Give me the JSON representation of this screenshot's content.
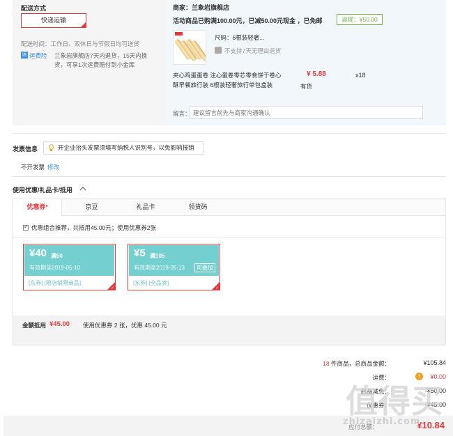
{
  "delivery": {
    "title": "配送方式",
    "method_button": "快递运输",
    "time_text": "配送时间：工作日、双休日与节假日均可送货",
    "insurance_icon": "运",
    "insurance_label": "运费险",
    "insurance_desc": "兰象岩旗舰店7天内退货，15天内换货，可享1次运费赔付到小金库"
  },
  "shop": {
    "name": "商家：兰象岩旗舰店",
    "promo": "活动商品已购满100.00元，已减50.00元现金 ，已免邮",
    "rebate": "返现：¥50.00"
  },
  "product": {
    "spec": "尺码：6根装轻奢...",
    "no_return": "不支持7天无理由退货",
    "name": "夹心鸡蛋蛋卷 注心蛋卷零芯零食饼干卷心酥早餐旅行装 6根装轻奢旅行单包盒装",
    "price": "¥ 5.88",
    "stock": "有货",
    "qty": "x18"
  },
  "memo": {
    "label": "留言：",
    "placeholder": "建议留言前先与商家沟通确认"
  },
  "invoice": {
    "title": "发票信息",
    "tip": "开企业抬头发票须填写纳税人识别号，以免影响报销",
    "value": "不开发票",
    "edit": "修改"
  },
  "coupon_section": {
    "title": "使用优惠/礼品卡/抵用",
    "tabs": [
      {
        "label": "优惠券",
        "mark": "*"
      },
      {
        "label": "京豆"
      },
      {
        "label": "礼品卡"
      },
      {
        "label": "领货码"
      }
    ],
    "combo_text": "优惠组合推荐，共抵用45.00元；使用优惠券2张",
    "coupons": [
      {
        "amount": "¥40",
        "condition": "满50",
        "expiry": "有效期至2019-05-10",
        "scope": "[东券] [限店铺限商品]"
      },
      {
        "amount": "¥5",
        "condition": "满105",
        "expiry": "有效期至2019-05-13",
        "stack": "可叠加",
        "scope": "[东券] [全品类]"
      }
    ],
    "sum_label": "金额抵用",
    "sum_value": "¥45.00",
    "sum_desc": "使用优惠券 2 张，优惠 45.00 元"
  },
  "totals": {
    "count": "18",
    "count_suffix": " 件商品，总商品金额：",
    "goods_total": "¥105.84",
    "shipping_label": "运费：",
    "shipping_value": "¥0.00",
    "discount_label": "商品减免：",
    "discount_value": "-¥50.00",
    "coupon_label": "优惠券：",
    "coupon_value": "-¥45.00",
    "payable_label": "应付总额：",
    "payable_value": "¥10.84"
  },
  "watermark": {
    "text": "值得买",
    "url": "zhizaizhi.com"
  },
  "colors": {
    "accent": "#e4393c",
    "coupon_teal": "#74cfd1",
    "link": "#3a8ee6",
    "rebate_green": "#71b247"
  }
}
